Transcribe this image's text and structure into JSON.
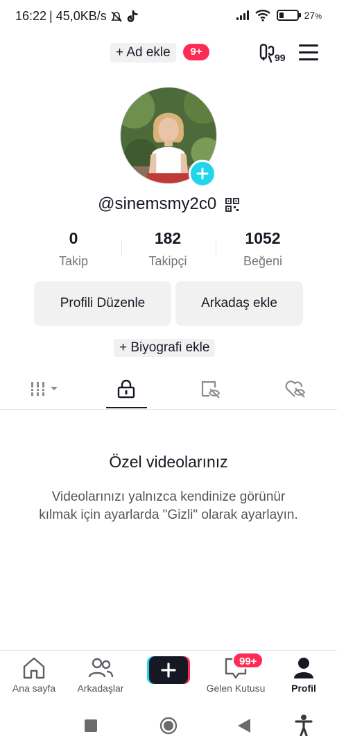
{
  "status_bar": {
    "time": "16:22",
    "speed": "| 45,0KB/s",
    "battery": "27",
    "battery_unit": "%",
    "battery_level": 0.27
  },
  "top_bar": {
    "add_account_label": "+ Ad ekle",
    "notification_badge": "9+"
  },
  "profile": {
    "username": "@sinemsmy2c0",
    "stats": [
      {
        "value": "0",
        "label": "Takip"
      },
      {
        "value": "182",
        "label": "Takipçi"
      },
      {
        "value": "1052",
        "label": "Beğeni"
      }
    ],
    "edit_button": "Profili Düzenle",
    "add_friend_button": "Arkadaş ekle",
    "add_bio": "+ Biyografi ekle"
  },
  "tabs": [
    {
      "icon": "grid-icon",
      "active": false
    },
    {
      "icon": "lock-icon",
      "active": true
    },
    {
      "icon": "eye-off-icon",
      "active": false
    },
    {
      "icon": "heart-hidden-icon",
      "active": false
    }
  ],
  "empty_state": {
    "title": "Özel videolarınız",
    "description": "Videolarınızı yalnızca kendinize görünür kılmak için ayarlarda \"Gizli\" olarak ayarlayın."
  },
  "bottom_nav": {
    "items": [
      {
        "label": "Ana sayfa",
        "icon": "home-icon"
      },
      {
        "label": "Arkadaşlar",
        "icon": "friends-icon"
      },
      {
        "label": "",
        "icon": "create-icon"
      },
      {
        "label": "Gelen Kutusu",
        "icon": "inbox-icon"
      },
      {
        "label": "Profil",
        "icon": "profile-icon"
      }
    ],
    "inbox_badge": "99+"
  },
  "colors": {
    "accent": "#fe2c55",
    "cyan": "#20d5ec",
    "text": "#161823"
  }
}
